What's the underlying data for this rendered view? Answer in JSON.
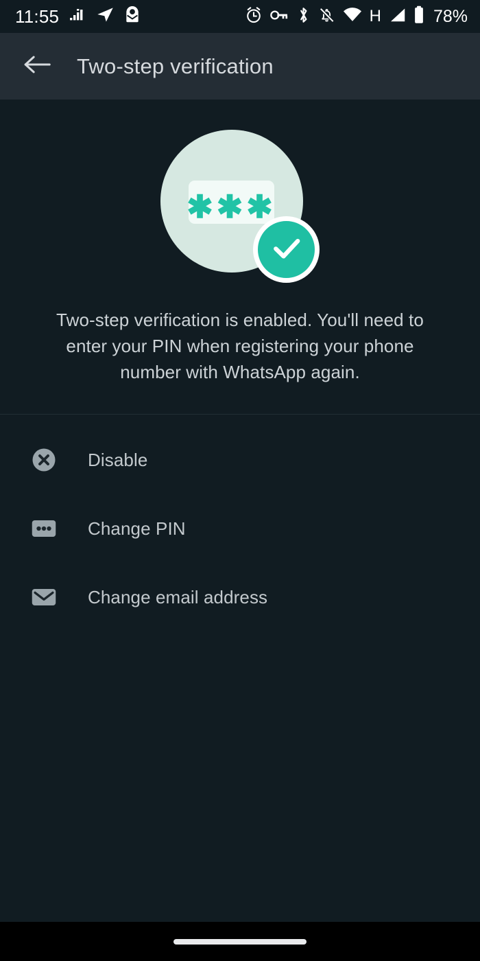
{
  "status_bar": {
    "clock": "11:55",
    "battery_percent": "78%",
    "network_type": "H",
    "left_icons": [
      "signal-bars-notification-icon",
      "paper-plane-icon",
      "mail-person-icon"
    ],
    "right_icons": [
      "alarm-clock-icon",
      "vpn-key-icon",
      "bluetooth-icon",
      "notifications-off-icon",
      "wifi-icon",
      "cellular-signal-icon",
      "battery-icon"
    ]
  },
  "app_bar": {
    "back_icon": "back-arrow-icon",
    "title": "Two-step verification"
  },
  "hero": {
    "circle_color": "#d6e8e1",
    "pin_box_color": "#f2faf7",
    "pin_mask": "✱✱✱",
    "accent_color": "#1fbfa3",
    "check_icon": "check-mark-icon"
  },
  "description": "Two-step verification is enabled. You'll need to enter your PIN when registering your phone number with WhatsApp again.",
  "options": [
    {
      "icon": "cancel-circle-icon",
      "label": "Disable"
    },
    {
      "icon": "password-dots-icon",
      "label": "Change PIN"
    },
    {
      "icon": "envelope-icon",
      "label": "Change email address"
    }
  ],
  "nav_bar": {
    "handle": "gesture-home-handle"
  }
}
